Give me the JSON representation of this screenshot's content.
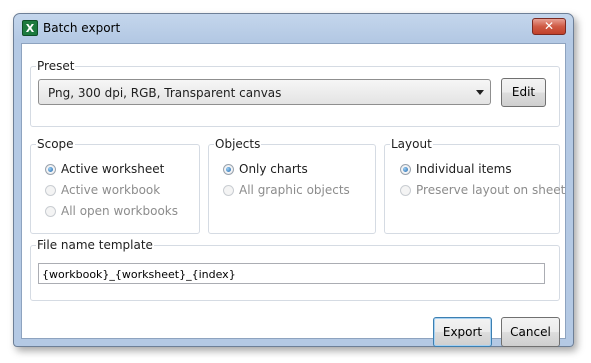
{
  "window": {
    "title": "Batch export",
    "icon": "excel-icon",
    "close_glyph": "✕"
  },
  "preset": {
    "label": "Preset",
    "selected": "Png, 300 dpi, RGB, Transparent canvas",
    "edit_label": "Edit"
  },
  "scope": {
    "label": "Scope",
    "options": [
      {
        "label": "Active worksheet",
        "checked": true,
        "enabled": true
      },
      {
        "label": "Active workbook",
        "checked": false,
        "enabled": false
      },
      {
        "label": "All open workbooks",
        "checked": false,
        "enabled": false
      }
    ]
  },
  "objects": {
    "label": "Objects",
    "options": [
      {
        "label": "Only charts",
        "checked": true,
        "enabled": true
      },
      {
        "label": "All graphic objects",
        "checked": false,
        "enabled": false
      }
    ]
  },
  "layout": {
    "label": "Layout",
    "options": [
      {
        "label": "Individual items",
        "checked": true,
        "enabled": true
      },
      {
        "label": "Preserve layout on sheet",
        "checked": false,
        "enabled": false
      }
    ]
  },
  "file_name": {
    "label": "File name template",
    "value": "{workbook}_{worksheet}_{index}"
  },
  "buttons": {
    "export_label": "Export",
    "cancel_label": "Cancel"
  }
}
